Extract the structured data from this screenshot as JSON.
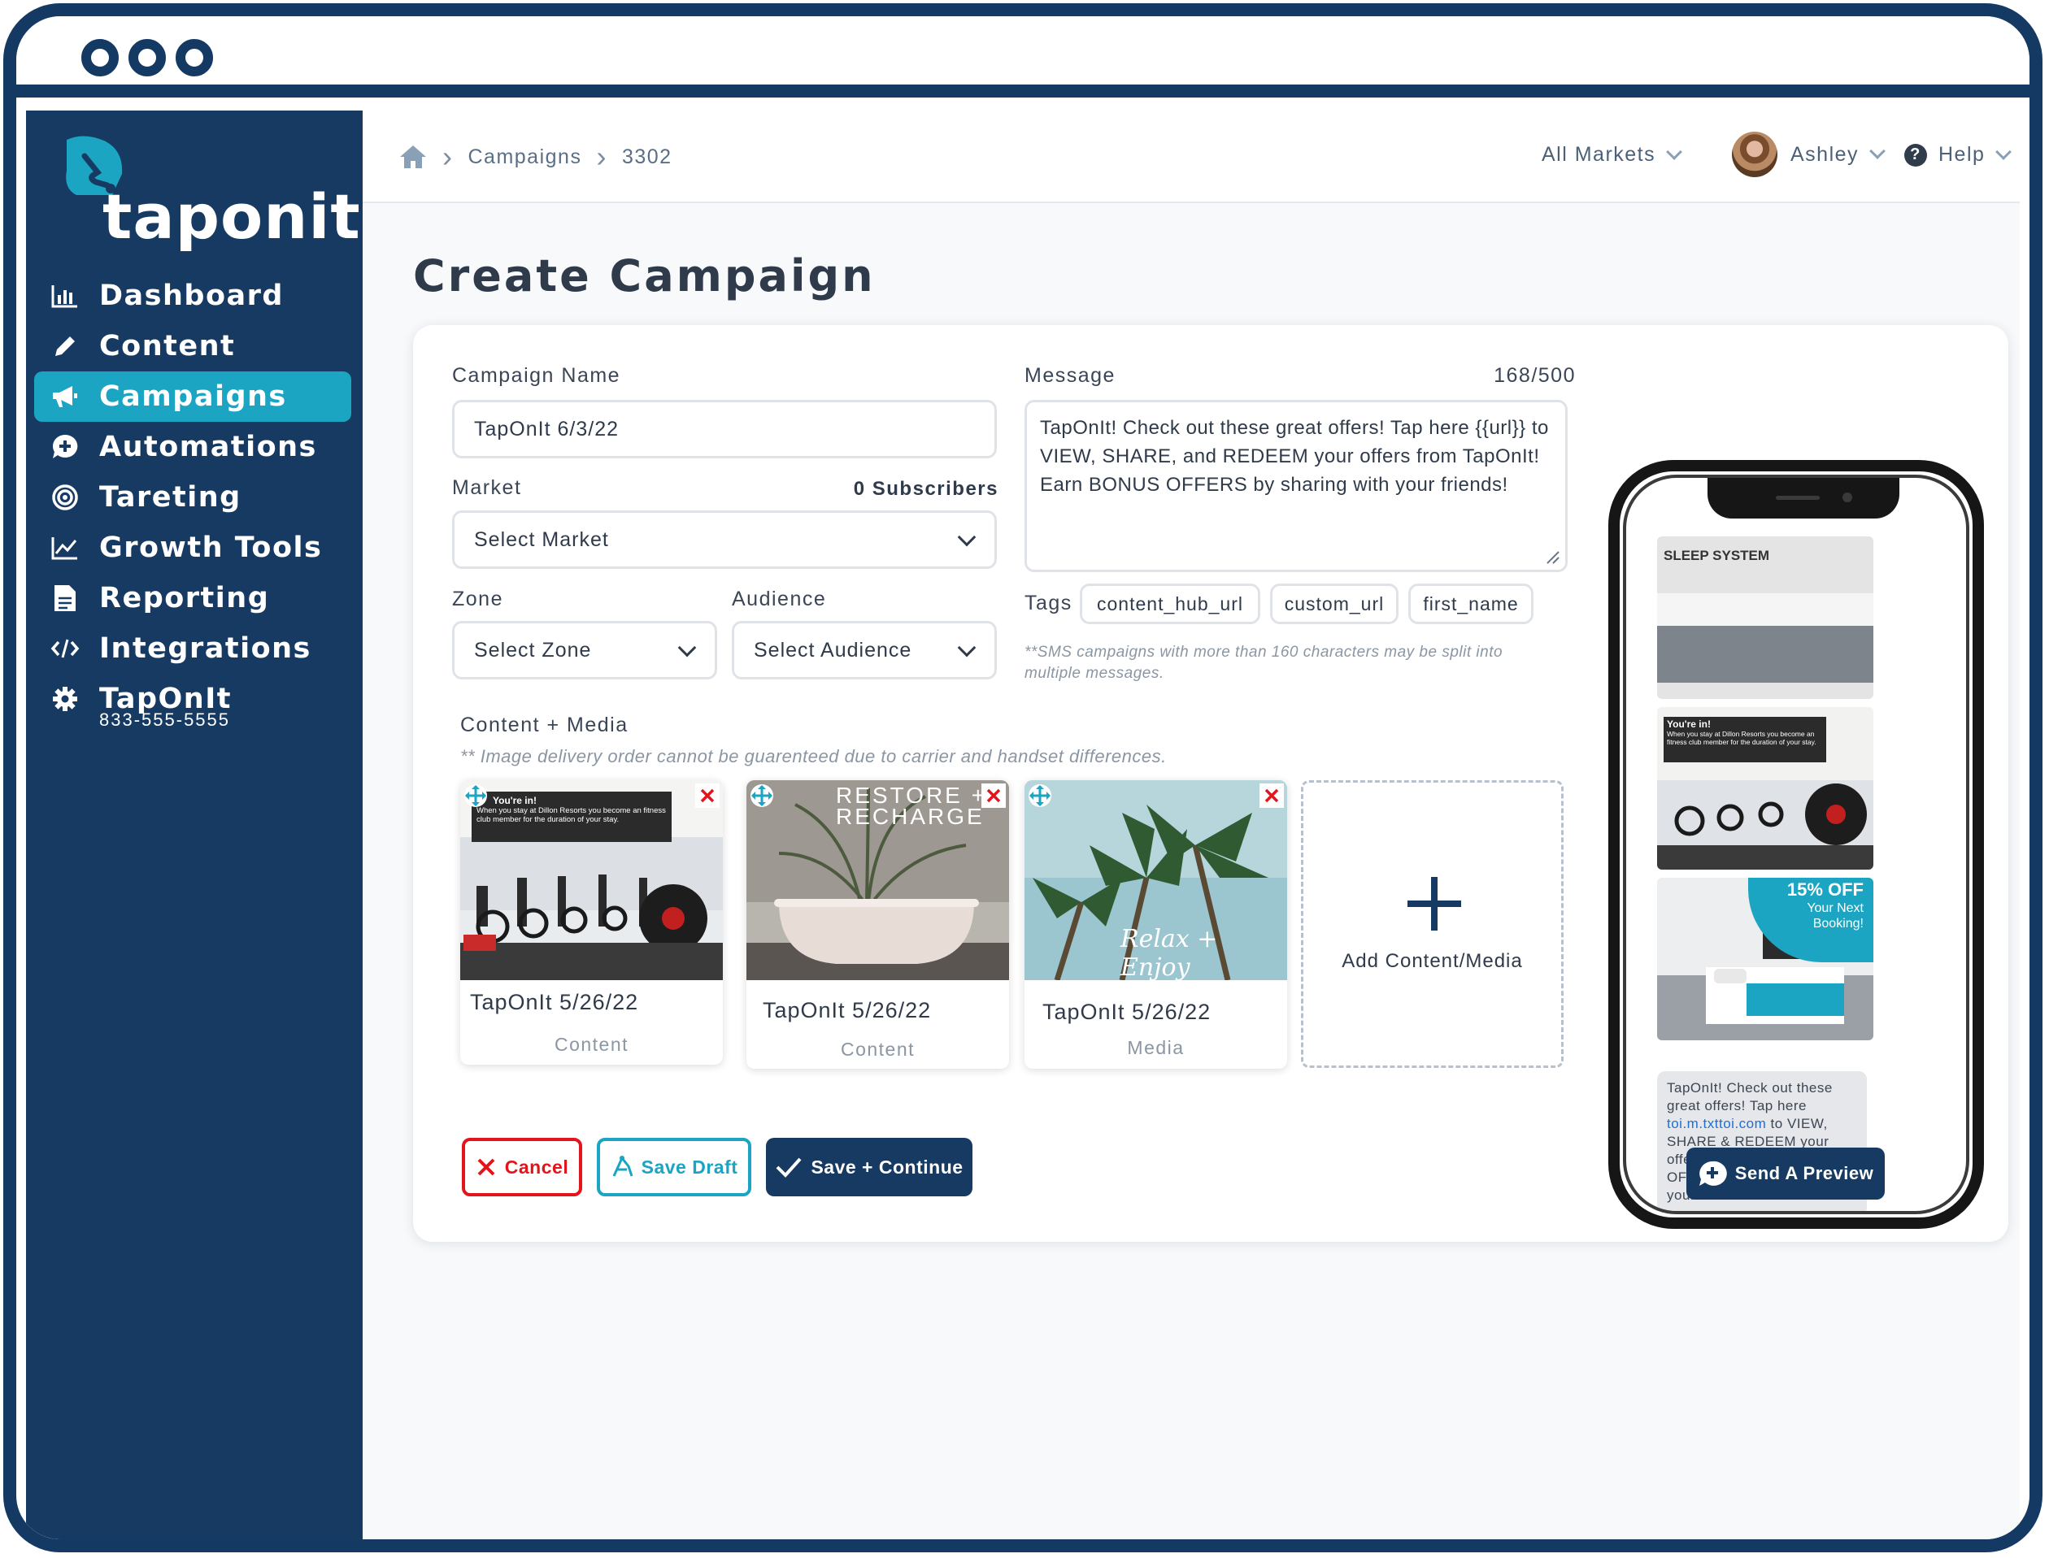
{
  "breadcrumb": {
    "items": [
      "Campaigns",
      "3302"
    ]
  },
  "header": {
    "markets_label": "All Markets",
    "user_name": "Ashley",
    "help_label": "Help"
  },
  "brand": {
    "name": "taponit"
  },
  "sidebar": {
    "items": [
      {
        "label": "Dashboard",
        "icon": "bar-chart-icon"
      },
      {
        "label": "Content",
        "icon": "pencil-icon"
      },
      {
        "label": "Campaigns",
        "icon": "megaphone-icon",
        "active": true
      },
      {
        "label": "Automations",
        "icon": "chat-plus-icon"
      },
      {
        "label": "Tareting",
        "icon": "target-icon"
      },
      {
        "label": "Growth Tools",
        "icon": "line-chart-icon"
      },
      {
        "label": "Reporting",
        "icon": "document-icon"
      },
      {
        "label": "Integrations",
        "icon": "code-icon"
      },
      {
        "label": "TapOnIt",
        "icon": "gear-icon",
        "sub": "833-555-5555"
      }
    ]
  },
  "page": {
    "title": "Create Campaign"
  },
  "form": {
    "campaign_name_label": "Campaign Name",
    "campaign_name_value": "TapOnIt 6/3/22",
    "market_label": "Market",
    "subscribers": "0 Subscribers",
    "market_value": "Select Market",
    "zone_label": "Zone",
    "zone_value": "Select Zone",
    "audience_label": "Audience",
    "audience_value": "Select Audience",
    "message_label": "Message",
    "message_count": "168/500",
    "message_text": "TapOnIt! Check out these great offers! Tap here {{url}} to VIEW, SHARE, and REDEEM your offers from TapOnIt! Earn BONUS OFFERS by sharing with your friends!",
    "tags_label": "Tags",
    "tags": [
      "content_hub_url",
      "custom_url",
      "first_name"
    ],
    "sms_note": "**SMS campaigns with more than 160 characters may be split into multiple messages."
  },
  "media": {
    "label": "Content + Media",
    "note": "** Image delivery order cannot be guarenteed due to carrier and handset differences.",
    "items": [
      {
        "title": "TapOnIt 5/26/22",
        "type": "Content",
        "overlay_title": "You're in!",
        "overlay_text": "When you stay at Dillon Resorts you become an fitness club member for the duration of your stay."
      },
      {
        "title": "TapOnIt 5/26/22",
        "type": "Content",
        "overlay_title": "RESTORE + RECHARGE"
      },
      {
        "title": "TapOnIt 5/26/22",
        "type": "Media",
        "overlay_title": "Relax + Enjoy"
      }
    ],
    "add_label": "Add Content/Media"
  },
  "actions": {
    "cancel": "Cancel",
    "save_draft": "Save Draft",
    "save_continue": "Save + Continue"
  },
  "preview": {
    "img1_label": "SLEEP SYSTEM",
    "img2_title": "You're in!",
    "img2_text": "When you stay at Dillon Resorts you become an fitness club member for the duration of your stay.",
    "offer_big": "15% OFF",
    "offer_small": "Your Next Booking!",
    "sms_pre": "TapOnIt! Check out these great offers! Tap here",
    "sms_link": "toi.m.txttoi.com",
    "sms_post": "to VIEW, SHARE & REDEEM your offers. Earn BONUS OFFERS by sharing with your friends!",
    "send_label": "Send A Preview"
  },
  "colors": {
    "navy": "#173a62",
    "teal": "#1ba5c2",
    "danger": "#e3151a",
    "frame": "#143a64"
  }
}
